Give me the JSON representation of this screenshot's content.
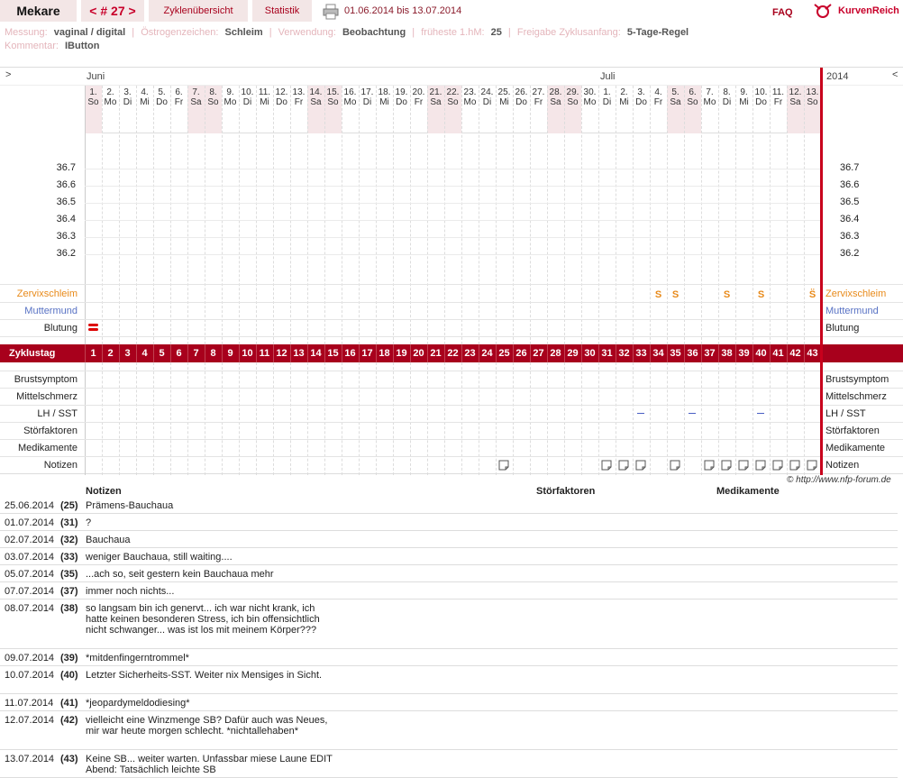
{
  "header": {
    "user_name": "Mekare",
    "cycle_nav": "< # 27 >",
    "tab_overview": "Zyklenübersicht",
    "tab_stats": "Statistik",
    "date_range": "01.06.2014 bis 13.07.2014",
    "faq": "FAQ",
    "logo_text": "KurvenReich"
  },
  "info": {
    "messung_label": "Messung:",
    "messung_value": "vaginal / digital",
    "oestrogen_label": "Östrogenzeichen:",
    "oestrogen_value": "Schleim",
    "verwendung_label": "Verwendung:",
    "verwendung_value": "Beobachtung",
    "fruehste_label": "früheste 1.hM:",
    "fruehste_value": "25",
    "freigabe_label": "Freigabe Zyklusanfang:",
    "freigabe_value": "5-Tage-Regel",
    "kommentar_label": "Kommentar:",
    "kommentar_value": "IButton"
  },
  "chart": {
    "nav_left": ">",
    "nav_right": "<",
    "month_june": "Juni",
    "month_july": "Juli",
    "year": "2014",
    "days": [
      {
        "d": "1.",
        "w": "So",
        "we": true
      },
      {
        "d": "2.",
        "w": "Mo",
        "we": false
      },
      {
        "d": "3.",
        "w": "Di",
        "we": false
      },
      {
        "d": "4.",
        "w": "Mi",
        "we": false
      },
      {
        "d": "5.",
        "w": "Do",
        "we": false
      },
      {
        "d": "6.",
        "w": "Fr",
        "we": false
      },
      {
        "d": "7.",
        "w": "Sa",
        "we": true
      },
      {
        "d": "8.",
        "w": "So",
        "we": true
      },
      {
        "d": "9.",
        "w": "Mo",
        "we": false
      },
      {
        "d": "10.",
        "w": "Di",
        "we": false
      },
      {
        "d": "11.",
        "w": "Mi",
        "we": false
      },
      {
        "d": "12.",
        "w": "Do",
        "we": false
      },
      {
        "d": "13.",
        "w": "Fr",
        "we": false
      },
      {
        "d": "14.",
        "w": "Sa",
        "we": true
      },
      {
        "d": "15.",
        "w": "So",
        "we": true
      },
      {
        "d": "16.",
        "w": "Mo",
        "we": false
      },
      {
        "d": "17.",
        "w": "Di",
        "we": false
      },
      {
        "d": "18.",
        "w": "Mi",
        "we": false
      },
      {
        "d": "19.",
        "w": "Do",
        "we": false
      },
      {
        "d": "20.",
        "w": "Fr",
        "we": false
      },
      {
        "d": "21.",
        "w": "Sa",
        "we": true
      },
      {
        "d": "22.",
        "w": "So",
        "we": true
      },
      {
        "d": "23.",
        "w": "Mo",
        "we": false
      },
      {
        "d": "24.",
        "w": "Di",
        "we": false
      },
      {
        "d": "25.",
        "w": "Mi",
        "we": false
      },
      {
        "d": "26.",
        "w": "Do",
        "we": false
      },
      {
        "d": "27.",
        "w": "Fr",
        "we": false
      },
      {
        "d": "28.",
        "w": "Sa",
        "we": true
      },
      {
        "d": "29.",
        "w": "So",
        "we": true
      },
      {
        "d": "30.",
        "w": "Mo",
        "we": false
      },
      {
        "d": "1.",
        "w": "Di",
        "we": false
      },
      {
        "d": "2.",
        "w": "Mi",
        "we": false
      },
      {
        "d": "3.",
        "w": "Do",
        "we": false
      },
      {
        "d": "4.",
        "w": "Fr",
        "we": false
      },
      {
        "d": "5.",
        "w": "Sa",
        "we": true
      },
      {
        "d": "6.",
        "w": "So",
        "we": true
      },
      {
        "d": "7.",
        "w": "Mo",
        "we": false
      },
      {
        "d": "8.",
        "w": "Di",
        "we": false
      },
      {
        "d": "9.",
        "w": "Mi",
        "we": false
      },
      {
        "d": "10.",
        "w": "Do",
        "we": false
      },
      {
        "d": "11.",
        "w": "Fr",
        "we": false
      },
      {
        "d": "12.",
        "w": "Sa",
        "we": true
      },
      {
        "d": "13.",
        "w": "So",
        "we": true
      }
    ],
    "temps": [
      "36.7",
      "36.6",
      "36.5",
      "36.4",
      "36.3",
      "36.2"
    ],
    "rows": {
      "zervix": "Zervixschleim",
      "muttermund": "Muttermund",
      "blutung": "Blutung",
      "zyklustag": "Zyklustag",
      "brust": "Brustsymptom",
      "mittel": "Mittelschmerz",
      "lh": "LH / SST",
      "stoer": "Störfaktoren",
      "medi": "Medikamente",
      "notizen": "Notizen"
    },
    "mucus_marks": [
      {
        "day": 34,
        "sym": "S"
      },
      {
        "day": 35,
        "sym": "S"
      },
      {
        "day": 38,
        "sym": "S"
      },
      {
        "day": 40,
        "sym": "S"
      },
      {
        "day": 43,
        "sym": "S̈"
      }
    ],
    "lh_days": [
      33,
      36,
      40
    ],
    "note_days": [
      25,
      31,
      32,
      33,
      35,
      37,
      38,
      39,
      40,
      41,
      42,
      43
    ],
    "bleeding_days": [
      1
    ]
  },
  "copyright": "© http://www.nfp-forum.de",
  "notes": {
    "col_notes": "Notizen",
    "col_stoer": "Störfaktoren",
    "col_medi": "Medikamente",
    "entries": [
      {
        "date": "25.06.2014",
        "day": "(25)",
        "text": "Prämens-Bauchaua"
      },
      {
        "date": "01.07.2014",
        "day": "(31)",
        "text": "?"
      },
      {
        "date": "02.07.2014",
        "day": "(32)",
        "text": "Bauchaua"
      },
      {
        "date": "03.07.2014",
        "day": "(33)",
        "text": "weniger Bauchaua, still waiting...."
      },
      {
        "date": "05.07.2014",
        "day": "(35)",
        "text": "...ach so, seit gestern kein Bauchaua mehr"
      },
      {
        "date": "07.07.2014",
        "day": "(37)",
        "text": "immer noch nichts..."
      },
      {
        "date": "08.07.2014",
        "day": "(38)",
        "text": "so langsam bin ich genervt... ich war nicht krank, ich hatte keinen besonderen Stress, ich bin offensichtlich nicht schwanger... was ist los mit meinem Körper???"
      },
      {
        "date": "09.07.2014",
        "day": "(39)",
        "text": "*mitdenfingerntrommel*"
      },
      {
        "date": "10.07.2014",
        "day": "(40)",
        "text": "Letzter Sicherheits-SST. Weiter nix Mensiges in Sicht."
      },
      {
        "date": "11.07.2014",
        "day": "(41)",
        "text": "*jeopardymeldodiesing*"
      },
      {
        "date": "12.07.2014",
        "day": "(42)",
        "text": "vielleicht eine Winzmenge SB? Dafür auch was Neues, mir war heute morgen schlecht. *nichtallehaben*"
      },
      {
        "date": "13.07.2014",
        "day": "(43)",
        "text": "Keine SB... weiter warten. Unfassbar miese Laune EDIT Abend: Tatsächlich leichte SB"
      }
    ]
  }
}
